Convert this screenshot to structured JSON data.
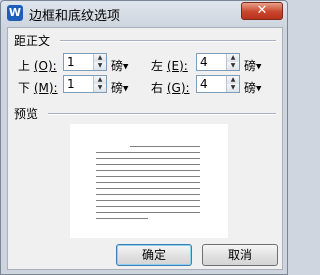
{
  "window": {
    "title": "边框和底纹选项",
    "app_icon_letter": "W",
    "close_glyph": "✕"
  },
  "margins": {
    "section_title": "距正文",
    "top": {
      "label": "上",
      "mnemonic": "(O):",
      "value": "1",
      "unit": "磅"
    },
    "bottom": {
      "label": "下",
      "mnemonic": "(M):",
      "value": "1",
      "unit": "磅"
    },
    "left": {
      "label": "左",
      "mnemonic": "(E):",
      "value": "4",
      "unit": "磅"
    },
    "right": {
      "label": "右",
      "mnemonic": "(G):",
      "value": "4",
      "unit": "磅"
    },
    "unit_dropdown_icon": "chevron-down-icon"
  },
  "preview": {
    "section_title": "预览"
  },
  "buttons": {
    "ok": "确定",
    "cancel": "取消"
  }
}
